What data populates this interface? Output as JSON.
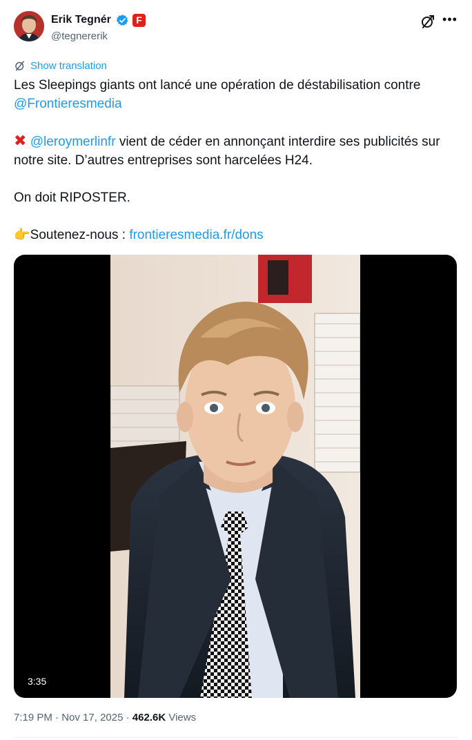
{
  "author": {
    "name": "Erik Tegnér",
    "handle": "@tegnererik",
    "affiliation_badge": "F",
    "verified_color": "#1d9bf0",
    "affiliation_color": "#e0201b"
  },
  "header_icons": [
    "grok-icon",
    "more-options-icon"
  ],
  "more_label": "•••",
  "show_translation": "Show translation",
  "tweet": {
    "line1": "Les Sleepings giants ont lancé une opération de déstabilisation contre",
    "mention_frontieres": "@Frontieresmedia",
    "x_emoji": "✖",
    "mention_leroymerlin": "@leroymerlinfr",
    "line2_rest": "vient de céder en annonçant interdire ses publicités sur notre site. D’autres entreprises sont harcelées H24.",
    "line3": "On doit RIPOSTER.",
    "point_emoji": "👉",
    "support_label": "Soutenez-nous :",
    "support_link": "frontieresmedia.fr/dons"
  },
  "video": {
    "duration": "3:35"
  },
  "meta": {
    "time": "7:19 PM",
    "sep1": "·",
    "date": "Nov 17, 2025",
    "sep2": "·",
    "views_count": "462.6K",
    "views_label": "Views"
  },
  "colors": {
    "link": "#1d9bf0",
    "secondary": "#536471",
    "text": "#0f1419"
  }
}
